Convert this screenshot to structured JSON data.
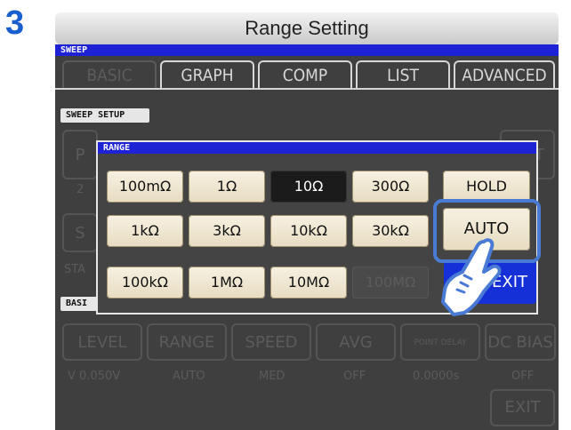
{
  "step_number": "3",
  "instruction_title": "Range Setting",
  "sweep_label": "SWEEP",
  "tabs": [
    {
      "label": "BASIC",
      "state": "dim"
    },
    {
      "label": "GRAPH",
      "state": "normal"
    },
    {
      "label": "COMP",
      "state": "normal"
    },
    {
      "label": "LIST",
      "state": "normal"
    },
    {
      "label": "ADVANCED",
      "state": "normal"
    }
  ],
  "sweep_setup_label": "SWEEP SETUP",
  "basic_section_label": "BASI",
  "bottom_params": [
    {
      "label": "LEVEL",
      "value": "V 0.050V"
    },
    {
      "label": "RANGE",
      "value": "AUTO"
    },
    {
      "label": "SPEED",
      "value": "MED"
    },
    {
      "label": "AVG",
      "value": "OFF"
    },
    {
      "label": "POINT DELAY",
      "value": "0.0000s"
    },
    {
      "label": "DC BIAS",
      "value": "OFF"
    }
  ],
  "background_exit_label": "EXIT",
  "background_partial": {
    "p": "P",
    "ent": "ENT",
    "two": "2",
    "s": "S",
    "sta": "STA"
  },
  "range_dialog": {
    "title": "RANGE",
    "rows": [
      [
        "100mΩ",
        "1Ω",
        "10Ω",
        "300Ω",
        "HOLD"
      ],
      [
        "1kΩ",
        "3kΩ",
        "10kΩ",
        "30kΩ",
        "AUTO"
      ],
      [
        "100kΩ",
        "1MΩ",
        "10MΩ",
        "100MΩ",
        "EXIT"
      ]
    ],
    "selected": "10Ω",
    "disabled": "100MΩ",
    "highlighted": "AUTO"
  },
  "colors": {
    "accent_blue": "#1d22d4",
    "highlight_ring": "#4a7bd4",
    "button_face": "#efe7d0",
    "exit_button": "#1530d6"
  }
}
